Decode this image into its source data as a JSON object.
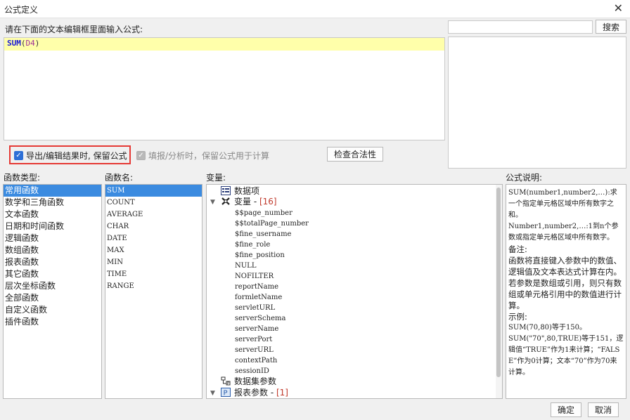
{
  "window": {
    "title": "公式定义",
    "close_glyph": "✕"
  },
  "editor": {
    "prompt": "请在下面的文本编辑框里面输入公式:",
    "formula_fn": "SUM",
    "formula_open": "(",
    "formula_arg": "D4",
    "formula_close": ")"
  },
  "search": {
    "value": "",
    "button_label": "搜索"
  },
  "options": {
    "keep_formula_export": {
      "label": "导出/编辑结果时, 保留公式",
      "checked": true
    },
    "keep_formula_fill": {
      "label": "填报/分析时，保留公式用于计算",
      "checked": true,
      "disabled": true
    },
    "validate_button": "检查合法性",
    "check_glyph": "✓"
  },
  "function_types": {
    "header": "函数类型:",
    "items": [
      "常用函数",
      "数学和三角函数",
      "文本函数",
      "日期和时间函数",
      "逻辑函数",
      "数组函数",
      "报表函数",
      "其它函数",
      "层次坐标函数",
      "全部函数",
      "自定义函数",
      "插件函数"
    ],
    "selected": "常用函数"
  },
  "function_names": {
    "header": "函数名:",
    "items": [
      "SUM",
      "COUNT",
      "AVERAGE",
      "CHAR",
      "DATE",
      "MAX",
      "MIN",
      "TIME",
      "RANGE"
    ],
    "selected": "SUM"
  },
  "variables": {
    "header": "变量:",
    "data_item": "数据项",
    "variables_label": "变量 -",
    "variables_count": "[16]",
    "items": [
      "$$page_number",
      "$$totalPage_number",
      "$fine_username",
      "$fine_role",
      "$fine_position",
      "NULL",
      "NOFILTER",
      "reportName",
      "formletName",
      "servletURL",
      "serverSchema",
      "serverName",
      "serverPort",
      "serverURL",
      "contextPath",
      "sessionID"
    ],
    "dataset_params": "数据集参数",
    "report_params_label": "报表参数 -",
    "report_params_count": "[1]",
    "expand_glyph": "▼"
  },
  "description": {
    "header": "公式说明:",
    "paragraphs": [
      "SUM(number1,number2,…):求一个指定单元格区域中所有数字之和。",
      "Number1,number2,…:1到n个参数或指定单元格区域中所有数字。",
      "备注:",
      "函数将直接键入参数中的数值、逻辑值及文本表达式计算在内。若参数是数组或引用，则只有数组或单元格引用中的数值进行计算。",
      "示例:",
      "SUM(70,80)等于150。",
      "SUM(\"70\",80,TRUE)等于151，逻辑值“TRUE”作为1来计算；“FALSE”作为0计算；文本“70”作为70来计算。"
    ]
  },
  "footer": {
    "ok": "确定",
    "cancel": "取消"
  }
}
